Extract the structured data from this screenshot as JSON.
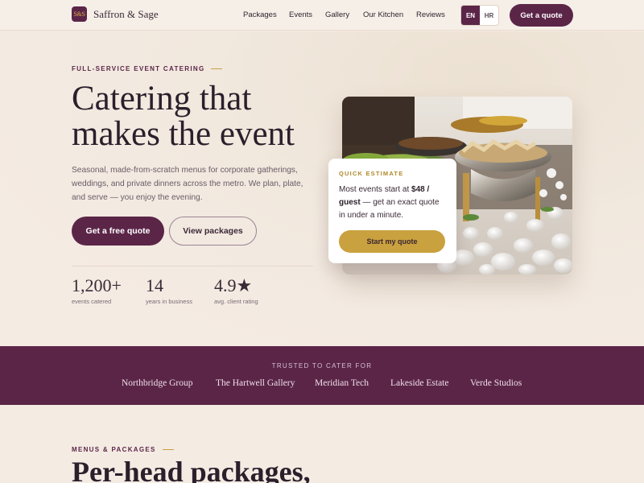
{
  "brand": {
    "mark": "S&S",
    "name": "Saffron & Sage"
  },
  "nav": {
    "links": [
      "Packages",
      "Events",
      "Gallery",
      "Our Kitchen",
      "Reviews"
    ],
    "lang": {
      "active": "EN",
      "other": "HR"
    },
    "cta": "Get a quote"
  },
  "hero": {
    "eyebrow": "FULL-SERVICE EVENT CATERING",
    "title_line1": "Catering that",
    "title_line2": "makes the event",
    "description": "Seasonal, made-from-scratch menus for corporate gatherings, weddings, and private dinners across the metro. We plan, plate, and serve — you enjoy the evening.",
    "primary_button": "Get a free quote",
    "secondary_button": "View packages",
    "stats": [
      {
        "value": "1,200+",
        "label": "events catered"
      },
      {
        "value": "14",
        "label": "years in business"
      },
      {
        "value": "4.9★",
        "label": "avg. client rating"
      }
    ]
  },
  "estimate": {
    "label": "QUICK ESTIMATE",
    "text_prefix": "Most events start at ",
    "price": "$48 / guest",
    "text_suffix": " — get an exact quote in under a minute.",
    "button": "Start my quote"
  },
  "trust": {
    "label": "TRUSTED TO CATER FOR",
    "clients": [
      "Northbridge Group",
      "The Hartwell Gallery",
      "Meridian Tech",
      "Lakeside Estate",
      "Verde Studios"
    ]
  },
  "packages": {
    "eyebrow": "MENUS & PACKAGES",
    "title": "Per-head packages,"
  },
  "colors": {
    "plum": "#5b2548",
    "gold": "#c9a13e",
    "cream": "#f4ebe3"
  }
}
